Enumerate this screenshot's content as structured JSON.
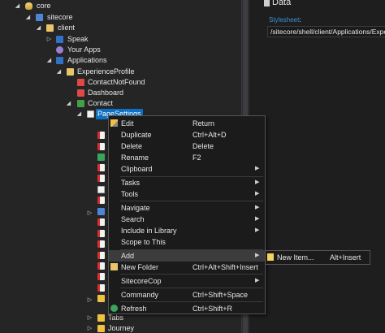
{
  "tree": {
    "items": [
      {
        "label": "core"
      },
      {
        "label": "sitecore"
      },
      {
        "label": "client"
      },
      {
        "label": "Speak"
      },
      {
        "label": "Your Apps"
      },
      {
        "label": "Applications"
      },
      {
        "label": "ExperienceProfile"
      },
      {
        "label": "ContactNotFound"
      },
      {
        "label": "Dashboard"
      },
      {
        "label": "Contact"
      },
      {
        "label": "PageSettings"
      },
      {
        "label": "Tabs"
      },
      {
        "label": "Journey"
      }
    ]
  },
  "details": {
    "title": "Data",
    "field_label": "Stylesheet",
    "field_colon": ":",
    "field_value": "/sitecore/shell/client/Applications/ExperienceProfile"
  },
  "menu": {
    "items": [
      {
        "label": "Edit",
        "shortcut": "Return"
      },
      {
        "label": "Duplicate",
        "shortcut": "Ctrl+Alt+D"
      },
      {
        "label": "Delete",
        "shortcut": "Delete"
      },
      {
        "label": "Rename",
        "shortcut": "F2"
      },
      {
        "label": "Clipboard",
        "shortcut": ""
      },
      {
        "label": "Tasks",
        "shortcut": ""
      },
      {
        "label": "Tools",
        "shortcut": ""
      },
      {
        "label": "Navigate",
        "shortcut": ""
      },
      {
        "label": "Search",
        "shortcut": ""
      },
      {
        "label": "Include in Library",
        "shortcut": ""
      },
      {
        "label": "Scope to This",
        "shortcut": ""
      },
      {
        "label": "Add",
        "shortcut": ""
      },
      {
        "label": "New Folder",
        "shortcut": "Ctrl+Alt+Shift+Insert"
      },
      {
        "label": "SitecoreCop",
        "shortcut": ""
      },
      {
        "label": "Commandy",
        "shortcut": "Ctrl+Shift+Space"
      },
      {
        "label": "Refresh",
        "shortcut": "Ctrl+Shift+R"
      }
    ],
    "arrow_glyph": "▶"
  },
  "submenu": {
    "label": "New Item...",
    "shortcut": "Alt+Insert"
  },
  "glyphs": {
    "expanded": "◢",
    "collapsed": "▷"
  },
  "colors": {
    "selection": "#0e70c0",
    "link_label": "#3b8ed8"
  }
}
